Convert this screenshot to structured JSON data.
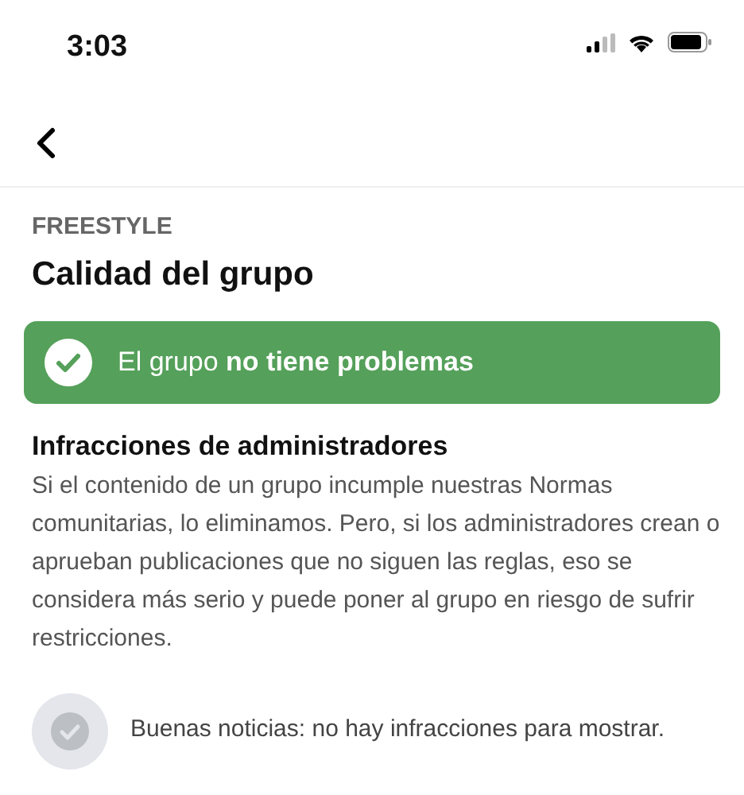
{
  "status_bar": {
    "time": "3:03"
  },
  "header": {
    "section": "FREESTYLE",
    "title": "Calidad del grupo"
  },
  "status_banner": {
    "text": "El grupo **no tiene problemas**",
    "color": "#55a05a"
  },
  "admin_violations": {
    "heading": "Infracciones de administradores",
    "description": "Si el contenido de un grupo incumple nuestras Normas comunitarias, lo eliminamos. Pero, si los administradores crean o aprueban publicaciones que no siguen las reglas, eso se considera más serio y puede poner al grupo en riesgo de sufrir restricciones.",
    "empty_message": "Buenas noticias: no hay infracciones para mostrar."
  }
}
